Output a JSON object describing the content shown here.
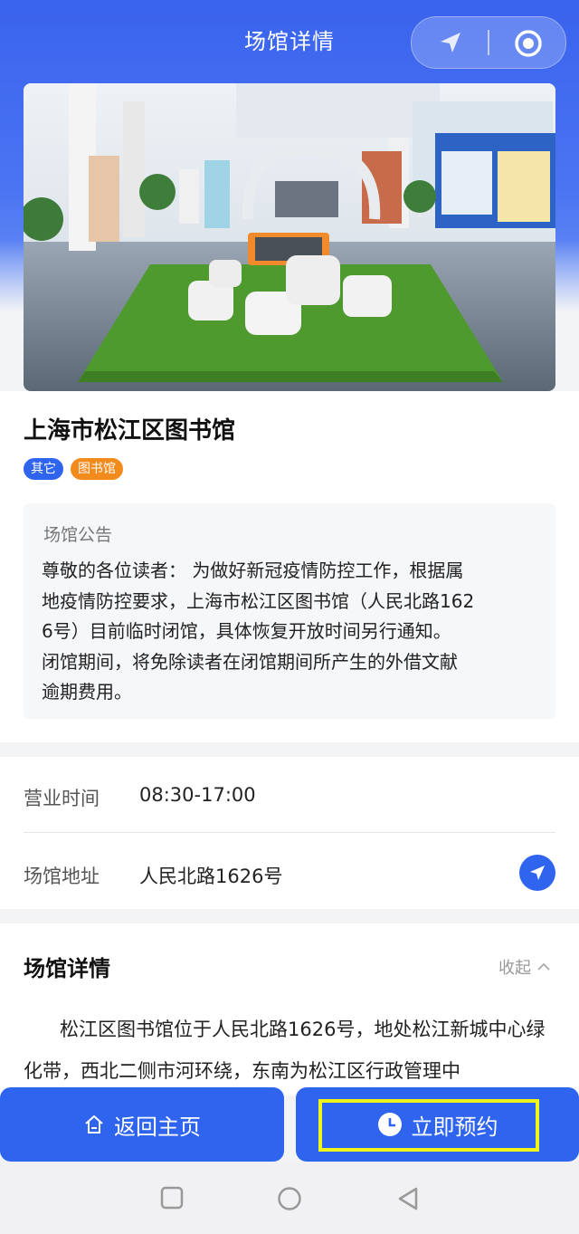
{
  "header": {
    "title": "场馆详情"
  },
  "capsule": {
    "location_icon": "location-arrow-icon",
    "target_icon": "target-icon"
  },
  "hero": {
    "icon": "library-interior-photo"
  },
  "venue": {
    "name": "上海市松江区图书馆",
    "tags": [
      "其它",
      "图书馆"
    ]
  },
  "notice": {
    "title": "场馆公告",
    "lines": [
      "尊敬的各位读者： 为做好新冠疫情防控工作，根据属",
      "地疫情防控要求，上海市松江区图书馆（人民北路162",
      "6号）目前临时闭馆，具体恢复开放时间另行通知。",
      "闭馆期间，将免除读者在闭馆期间所产生的外借文献",
      "逾期费用。"
    ]
  },
  "info": {
    "hours_label": "营业时间",
    "hours_value": "08:30-17:00",
    "address_label": "场馆地址",
    "address_value": "人民北路1626号"
  },
  "details": {
    "title": "场馆详情",
    "collapse_label": "收起",
    "text": "松江区图书馆位于人民北路1626号，地处松江新城中心绿化带，西北二侧市河环绕，东南为松江区行政管理中"
  },
  "buttons": {
    "home_label": "返回主页",
    "book_label": "立即预约"
  },
  "colors": {
    "accent": "#2f64ee",
    "tag_orange": "#f28a1c",
    "highlight": "#f0f519"
  }
}
